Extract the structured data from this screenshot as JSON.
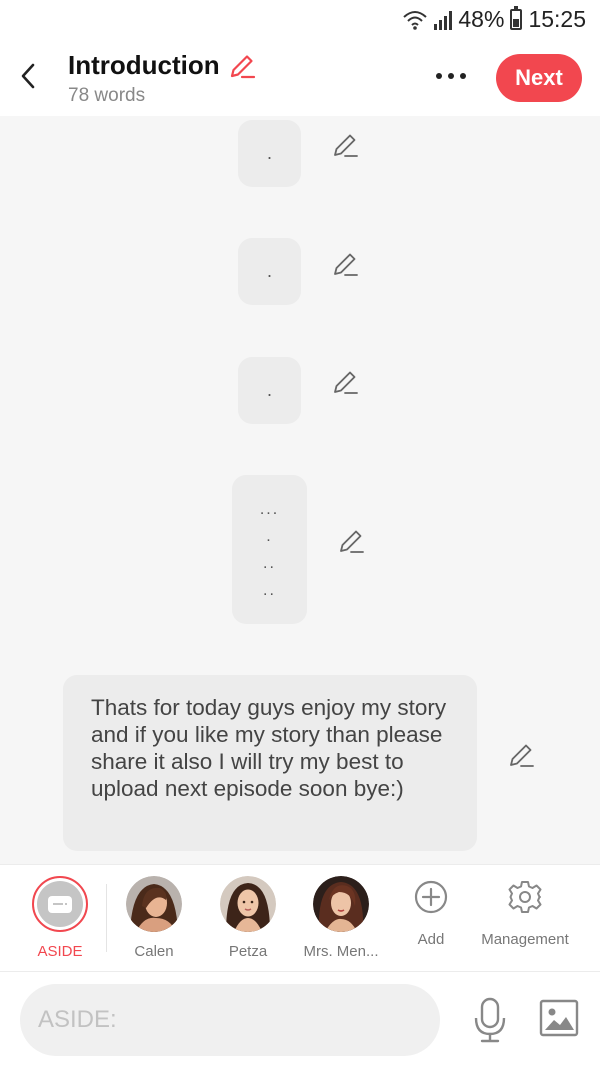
{
  "status": {
    "battery": "48%",
    "time": "15:25",
    "battery_level": 0.48
  },
  "header": {
    "title": "Introduction",
    "word_count": "78 words",
    "next_label": "Next"
  },
  "messages": [
    {
      "lines": [
        "."
      ]
    },
    {
      "lines": [
        "."
      ]
    },
    {
      "lines": [
        "."
      ]
    },
    {
      "lines": [
        "...",
        ".",
        "..",
        ".."
      ]
    },
    {
      "text": "Thats for today guys enjoy my story and if you like my story than please share it also I will try my best to upload next episode soon bye:)"
    }
  ],
  "characters": [
    {
      "label": "ASIDE"
    },
    {
      "label": "Calen"
    },
    {
      "label": "Petza"
    },
    {
      "label": "Mrs. Men..."
    }
  ],
  "tools": {
    "add_label": "Add",
    "management_label": "Management"
  },
  "input": {
    "placeholder": "ASIDE:"
  },
  "colors": {
    "accent": "#f2474f",
    "bubble": "#ececec",
    "background": "#f6f6f6"
  }
}
